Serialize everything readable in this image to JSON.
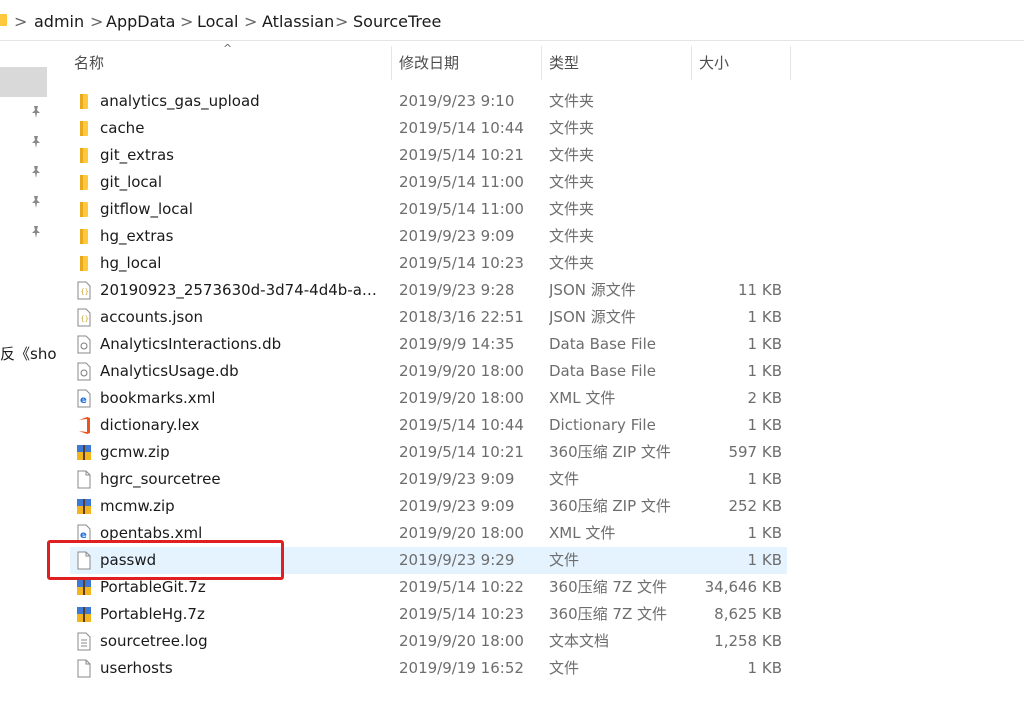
{
  "breadcrumb": [
    "admin",
    "AppData",
    "Local",
    "Atlassian",
    "SourceTree"
  ],
  "breadcrumb_separator": ">",
  "columns": {
    "name": "名称",
    "date": "修改日期",
    "type": "类型",
    "size": "大小"
  },
  "nav_partial_text": "反《sho",
  "files": [
    {
      "name": "analytics_gas_upload",
      "date": "2019/9/23 9:10",
      "type": "文件夹",
      "size": "",
      "icon": "folder-icon"
    },
    {
      "name": "cache",
      "date": "2019/5/14 10:44",
      "type": "文件夹",
      "size": "",
      "icon": "folder-icon"
    },
    {
      "name": "git_extras",
      "date": "2019/5/14 10:21",
      "type": "文件夹",
      "size": "",
      "icon": "folder-icon"
    },
    {
      "name": "git_local",
      "date": "2019/5/14 11:00",
      "type": "文件夹",
      "size": "",
      "icon": "folder-icon"
    },
    {
      "name": "gitflow_local",
      "date": "2019/5/14 11:00",
      "type": "文件夹",
      "size": "",
      "icon": "folder-icon"
    },
    {
      "name": "hg_extras",
      "date": "2019/9/23 9:09",
      "type": "文件夹",
      "size": "",
      "icon": "folder-icon"
    },
    {
      "name": "hg_local",
      "date": "2019/5/14 10:23",
      "type": "文件夹",
      "size": "",
      "icon": "folder-icon"
    },
    {
      "name": "20190923_2573630d-3d74-4d4b-a8...",
      "date": "2019/9/23 9:28",
      "type": "JSON 源文件",
      "size": "11 KB",
      "icon": "json-file-icon"
    },
    {
      "name": "accounts.json",
      "date": "2018/3/16 22:51",
      "type": "JSON 源文件",
      "size": "1 KB",
      "icon": "json-file-icon"
    },
    {
      "name": "AnalyticsInteractions.db",
      "date": "2019/9/9 14:35",
      "type": "Data Base File",
      "size": "1 KB",
      "icon": "db-file-icon"
    },
    {
      "name": "AnalyticsUsage.db",
      "date": "2019/9/20 18:00",
      "type": "Data Base File",
      "size": "1 KB",
      "icon": "db-file-icon"
    },
    {
      "name": "bookmarks.xml",
      "date": "2019/9/20 18:00",
      "type": "XML 文件",
      "size": "2 KB",
      "icon": "xml-file-icon"
    },
    {
      "name": "dictionary.lex",
      "date": "2019/5/14 10:44",
      "type": "Dictionary File",
      "size": "1 KB",
      "icon": "office-file-icon"
    },
    {
      "name": "gcmw.zip",
      "date": "2019/5/14 10:21",
      "type": "360压缩 ZIP 文件",
      "size": "597 KB",
      "icon": "archive-icon"
    },
    {
      "name": "hgrc_sourcetree",
      "date": "2019/9/23 9:09",
      "type": "文件",
      "size": "1 KB",
      "icon": "blank-file-icon"
    },
    {
      "name": "mcmw.zip",
      "date": "2019/9/23 9:09",
      "type": "360压缩 ZIP 文件",
      "size": "252 KB",
      "icon": "archive-icon"
    },
    {
      "name": "opentabs.xml",
      "date": "2019/9/20 18:00",
      "type": "XML 文件",
      "size": "1 KB",
      "icon": "xml-file-icon"
    },
    {
      "name": "passwd",
      "date": "2019/9/23 9:29",
      "type": "文件",
      "size": "1 KB",
      "icon": "blank-file-icon"
    },
    {
      "name": "PortableGit.7z",
      "date": "2019/5/14 10:22",
      "type": "360压缩 7Z 文件",
      "size": "34,646 KB",
      "icon": "archive-icon"
    },
    {
      "name": "PortableHg.7z",
      "date": "2019/5/14 10:23",
      "type": "360压缩 7Z 文件",
      "size": "8,625 KB",
      "icon": "archive-icon"
    },
    {
      "name": "sourcetree.log",
      "date": "2019/9/20 18:00",
      "type": "文本文档",
      "size": "1,258 KB",
      "icon": "text-file-icon"
    },
    {
      "name": "userhosts",
      "date": "2019/9/19 16:52",
      "type": "文件",
      "size": "1 KB",
      "icon": "blank-file-icon"
    }
  ],
  "selected_file": "passwd",
  "highlight_color": "#e02020",
  "selection_color": "#e5f3ff",
  "folder_color": "#ffc83d"
}
